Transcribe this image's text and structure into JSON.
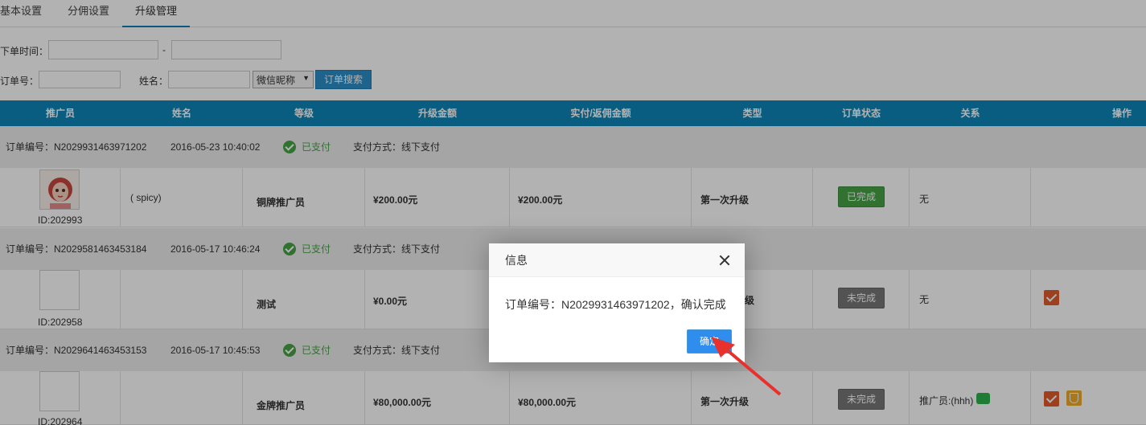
{
  "tabs": [
    {
      "label": "基本设置"
    },
    {
      "label": "分佣设置"
    },
    {
      "label": "升级管理"
    }
  ],
  "filters": {
    "order_time_label": "下单时间：",
    "time_separator": "-",
    "order_no_label": "订单号：",
    "name_label": "姓名：",
    "name_type_select": "微信昵称",
    "search_button": "订单搜索"
  },
  "table": {
    "headers": [
      "推广员",
      "姓名",
      "等级",
      "升级金额",
      "实付/返佣金额",
      "类型",
      "订单状态",
      "关系",
      "操作"
    ],
    "orders": [
      {
        "order_no": "订单编号：N2029931463971202",
        "time": "2016-05-23 10:40:02",
        "paid": "已支付",
        "pay_method": "支付方式：线下支付",
        "promoter_id": "ID:202993",
        "name": "( spicy)",
        "level": "铜牌推广员",
        "upgrade_amount": "¥200.00元",
        "paid_amount": "¥200.00元",
        "type": "第一次升级",
        "status": "已完成",
        "relation": "无"
      },
      {
        "order_no": "订单编号：N2029581463453184",
        "time": "2016-05-17 10:46:24",
        "paid": "已支付",
        "pay_method": "支付方式：线下支付",
        "promoter_id": "ID:202958",
        "name": "",
        "level": "测试",
        "upgrade_amount": "¥0.00元",
        "type_partial": "级",
        "status": "未完成",
        "relation": "无"
      },
      {
        "order_no": "订单编号：N2029641463453153",
        "time": "2016-05-17 10:45:53",
        "paid": "已支付",
        "pay_method": "支付方式：线下支付",
        "promoter_id": "ID:202964",
        "name": "",
        "level": "金牌推广员",
        "upgrade_amount": "¥80,000.00元",
        "paid_amount": "¥80,000.00元",
        "type": "第一次升级",
        "status": "未完成",
        "relation": "推广员:(hhh)"
      }
    ]
  },
  "dialog": {
    "title": "信息",
    "message": "订单编号：N2029931463971202，确认完成",
    "ok_button": "确定"
  },
  "colors": {
    "header_bg": "#0e86b8",
    "done_green": "#47a447",
    "pending_gray": "#777777",
    "dialog_ok": "#2e8ded",
    "annotation_arrow": "#e8302c"
  },
  "icons": [
    "paid-check-icon",
    "complete-check-icon",
    "verify-icon",
    "wechat-icon",
    "close-icon",
    "annotation-arrow"
  ]
}
